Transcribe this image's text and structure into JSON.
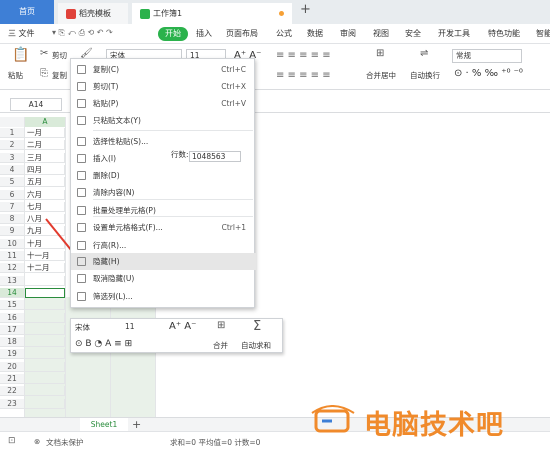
{
  "tabs": {
    "home": "首页",
    "docer": "稻壳模板",
    "workbook": "工作簿1"
  },
  "menu": {
    "file": "三 文件",
    "start": "开始",
    "items": [
      "插入",
      "页面布局",
      "公式",
      "数据",
      "审阅",
      "视图",
      "安全",
      "开发工具",
      "特色功能",
      "智能"
    ]
  },
  "ribbon": {
    "paste": "粘贴",
    "cut": "剪切",
    "copy": "复制",
    "font_name": "宋体",
    "font_size": "11",
    "merge_center": "合并居中",
    "wrap": "自动换行",
    "number_format": "常规"
  },
  "formula_bar": {
    "name_box": "A14"
  },
  "grid": {
    "col_a": "A",
    "rows": [
      "1",
      "2",
      "3",
      "4",
      "5",
      "6",
      "7",
      "8",
      "9",
      "10",
      "11",
      "12",
      "13",
      "14",
      "15",
      "16",
      "17",
      "18",
      "19",
      "20",
      "21",
      "22",
      "23"
    ],
    "months": [
      "一月",
      "二月",
      "三月",
      "四月",
      "五月",
      "六月",
      "七月",
      "八月",
      "九月",
      "十月",
      "十一月",
      "十二月"
    ]
  },
  "context_menu": {
    "items": [
      {
        "label": "复制(C)",
        "shortcut": "Ctrl+C"
      },
      {
        "label": "剪切(T)",
        "shortcut": "Ctrl+X"
      },
      {
        "label": "粘贴(P)",
        "shortcut": "Ctrl+V"
      },
      {
        "label": "只粘贴文本(Y)",
        "shortcut": ""
      },
      {
        "label": "选择性粘贴(S)...",
        "shortcut": ""
      },
      {
        "label": "插入(I)",
        "shortcut": ""
      },
      {
        "label": "删除(D)",
        "shortcut": ""
      },
      {
        "label": "清除内容(N)",
        "shortcut": ""
      },
      {
        "label": "批量处理单元格(P)",
        "shortcut": ""
      },
      {
        "label": "设置单元格格式(F)...",
        "shortcut": "Ctrl+1"
      },
      {
        "label": "行高(R)...",
        "shortcut": ""
      },
      {
        "label": "隐藏(H)",
        "shortcut": ""
      },
      {
        "label": "取消隐藏(U)",
        "shortcut": ""
      },
      {
        "label": "筛选列(L)...",
        "shortcut": ""
      }
    ],
    "row_count_label": "行数:",
    "row_count_value": "1048563"
  },
  "mini_toolbar": {
    "font_name": "宋体",
    "font_size": "11",
    "merge": "合并",
    "autosum": "自动求和"
  },
  "sheet": {
    "name": "Sheet1"
  },
  "status": {
    "doc_unprotected": "文档未保护",
    "summary": "求和=0  平均值=0  计数=0"
  },
  "watermark": {
    "text": "电脑技术吧"
  }
}
